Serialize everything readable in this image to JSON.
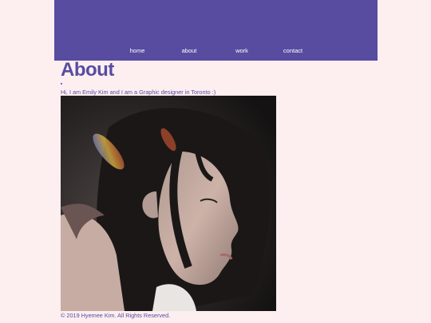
{
  "nav": {
    "items": [
      {
        "label": "home"
      },
      {
        "label": "about"
      },
      {
        "label": "work"
      },
      {
        "label": "contact"
      }
    ]
  },
  "page": {
    "title": "About",
    "intro": "Hi, I am Emily Kim and I am a Graphic designer in Toronto :)"
  },
  "footer": {
    "copyright": "© 2019 Hyemee Kim. All Rights Reserved."
  },
  "colors": {
    "brand": "#574ca0",
    "background": "#fdeef0"
  }
}
